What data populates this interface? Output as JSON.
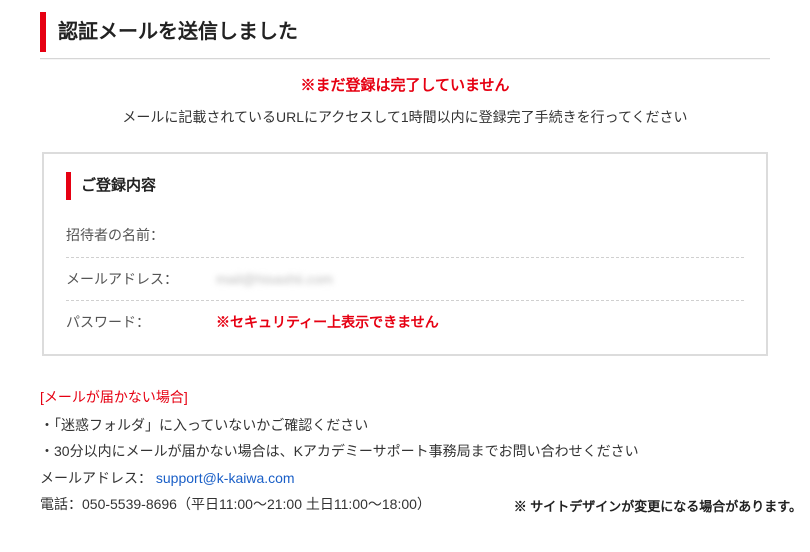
{
  "heading": "認証メールを送信しました",
  "warning": "※まだ登録は完了していません",
  "instruction": "メールに記載されているURLにアクセスして1時間以内に登録完了手続きを行ってください",
  "box": {
    "title": "ご登録内容",
    "fields": {
      "inviter_label": "招待者の名前：",
      "inviter_value": "",
      "email_label": "メールアドレス：",
      "email_value": "mail@hisashii.com",
      "password_label": "パスワード：",
      "password_value": "※セキュリティー上表示できません"
    }
  },
  "help": {
    "title": "[メールが届かない場合]",
    "line1": "「迷惑フォルダ」に入っていないかご確認ください",
    "line2": "30分以内にメールが届かない場合は、Kアカデミーサポート事務局までお問い合わせください",
    "contact_email_label": "メールアドレス：",
    "contact_email": "support@k-kaiwa.com",
    "phone_line": "電話：050-5539-8696（平日11:00～21:00 土日11:00～18:00）"
  },
  "footnote": "※ サイトデザインが変更になる場合があります。"
}
